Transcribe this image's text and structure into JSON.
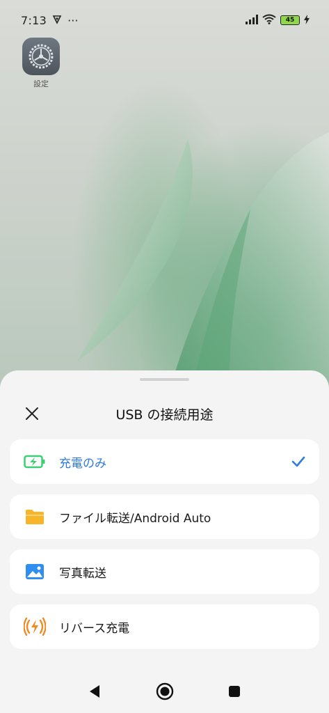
{
  "status_bar": {
    "time": "7:13",
    "overflow": "···",
    "battery_level": "45",
    "icons": [
      "vpn-shield-icon",
      "signal-icon",
      "wifi-icon",
      "battery-icon",
      "charging-bolt-icon"
    ]
  },
  "home": {
    "apps": [
      {
        "label": "設定",
        "icon": "gear-icon"
      }
    ]
  },
  "sheet": {
    "title": "USB の接続用途",
    "close_icon": "close-icon",
    "options": [
      {
        "label": "充電のみ",
        "icon": "battery-charging-icon",
        "selected": true
      },
      {
        "label": "ファイル転送/Android Auto",
        "icon": "folder-icon",
        "selected": false
      },
      {
        "label": "写真転送",
        "icon": "image-icon",
        "selected": false
      },
      {
        "label": "リバース充電",
        "icon": "reverse-charging-icon",
        "selected": false
      }
    ],
    "accent_color": "#2f7bde"
  },
  "nav_bar": {
    "buttons": [
      "back-icon",
      "home-icon",
      "recents-icon"
    ]
  }
}
